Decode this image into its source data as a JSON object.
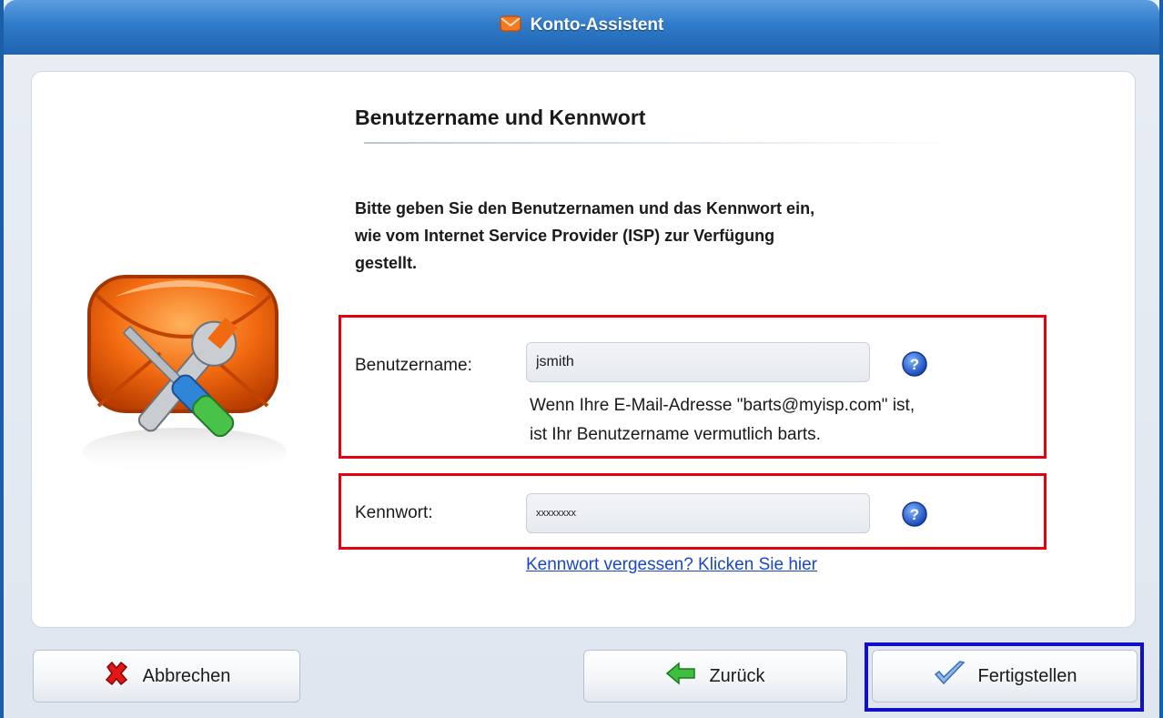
{
  "window": {
    "title": "Konto-Assistent",
    "title_icon": "envelope-icon"
  },
  "main": {
    "heading": "Benutzername und Kennwort",
    "instructions": [
      "Bitte geben Sie den Benutzernamen und das Kennwort ein,",
      "wie vom Internet Service Provider (ISP) zur Verfügung",
      "gestellt."
    ],
    "illustration": "envelope-tools-icon"
  },
  "username": {
    "label": "Benutzername:",
    "value": "jsmith",
    "help_icon": "help-icon",
    "hint": [
      "Wenn Ihre E-Mail-Adresse \"barts@myisp.com\" ist,",
      "ist Ihr Benutzername vermutlich barts."
    ]
  },
  "password": {
    "label": "Kennwort:",
    "value": "xxxxxxxx",
    "help_icon": "help-icon",
    "forgot_link": "Kennwort vergessen? Klicken Sie hier"
  },
  "buttons": {
    "cancel": {
      "label": "Abbrechen",
      "icon": "red-x-icon"
    },
    "back": {
      "label": "Zurück",
      "icon": "green-arrow-left-icon"
    },
    "finish": {
      "label": "Fertigstellen",
      "icon": "checkmark-icon"
    }
  },
  "colors": {
    "highlight_red": "#e3000f",
    "highlight_blue": "#1010c8",
    "titlebar": "#2f7bc9",
    "link": "#1a46c8"
  }
}
